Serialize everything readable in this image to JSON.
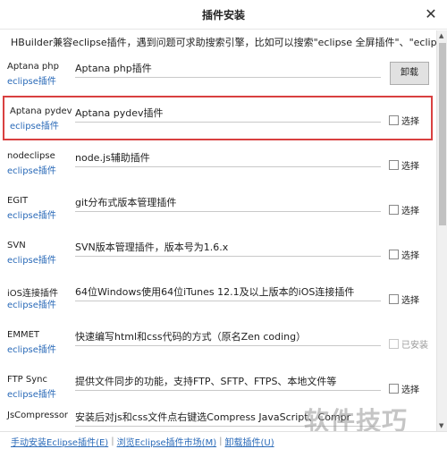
{
  "window": {
    "title": "插件安装",
    "close_glyph": "✕"
  },
  "hint": "HBuilder兼容eclipse插件，遇到问题可求助搜索引擎，比如可以搜索\"eclipse 全屏插件\"、\"eclipse SVN用法\"",
  "plugins": [
    {
      "name": "Aptana php",
      "tag": "eclipse插件",
      "desc": "Aptana php插件",
      "action": "卸载",
      "state": "installed"
    },
    {
      "name": "Aptana pydev",
      "tag": "eclipse插件",
      "desc": "Aptana pydev插件",
      "action": "选择",
      "state": "selectable",
      "highlighted": true
    },
    {
      "name": "nodeclipse",
      "tag": "eclipse插件",
      "desc": "node.js辅助插件",
      "action": "选择",
      "state": "selectable"
    },
    {
      "name": "EGIT",
      "tag": "eclipse插件",
      "desc": "git分布式版本管理插件",
      "action": "选择",
      "state": "selectable"
    },
    {
      "name": "SVN",
      "tag": "eclipse插件",
      "desc": "SVN版本管理插件，版本号为1.6.x",
      "action": "选择",
      "state": "selectable"
    },
    {
      "name": "iOS连接插件",
      "tag": "eclipse插件",
      "desc": "64位Windows使用64位iTunes 12.1及以上版本的iOS连接插件",
      "action": "选择",
      "state": "selectable"
    },
    {
      "name": "EMMET",
      "tag": "eclipse插件",
      "desc": "快速编写html和css代码的方式（原名Zen coding）",
      "action": "已安装",
      "state": "disabled"
    },
    {
      "name": "FTP Sync",
      "tag": "eclipse插件",
      "desc": "提供文件同步的功能，支持FTP、SFTP、FTPS、本地文件等",
      "action": "选择",
      "state": "selectable"
    },
    {
      "name": "JsCompressor",
      "tag": "",
      "desc": "安装后对js和css文件点右键选Compress JavaScript、Compr",
      "action": "",
      "state": "cut"
    }
  ],
  "footer": {
    "links": [
      "手动安装Eclipse插件(E)",
      "浏览Eclipse插件市场(M)",
      "卸载插件(U)"
    ],
    "separator": "|"
  },
  "watermark": "软件技巧",
  "scroll": {
    "up_glyph": "▲",
    "down_glyph": "▼"
  }
}
